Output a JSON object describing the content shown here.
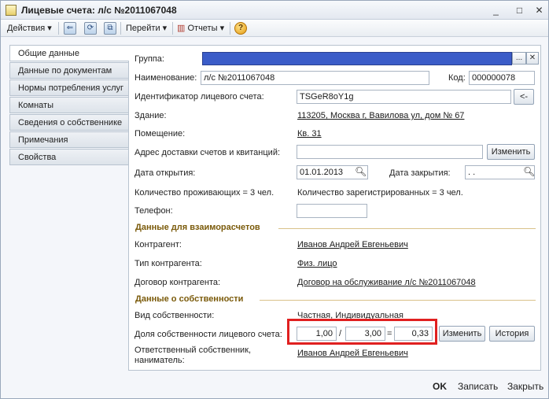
{
  "window": {
    "title": "Лицевые счета: л/с №2011067048"
  },
  "window_controls": {
    "minimize": "_",
    "maximize": "□",
    "close": "✕"
  },
  "toolbar": {
    "actions_label": "Действия",
    "goto_label": "Перейти",
    "reports_label": "Отчеты",
    "help_glyph": "?"
  },
  "tabs": [
    {
      "label": "Общие данные",
      "active": true
    },
    {
      "label": "Данные по документам"
    },
    {
      "label": "Нормы потребления услуг"
    },
    {
      "label": "Комнаты"
    },
    {
      "label": "Сведения о собственнике"
    },
    {
      "label": "Примечания"
    },
    {
      "label": "Свойства"
    }
  ],
  "form": {
    "group_label": "Группа:",
    "group_value": "",
    "group_select": "...",
    "group_clear": "✕",
    "name_label": "Наименование:",
    "name_value": "л/с №2011067048",
    "code_label": "Код:",
    "code_value": "000000078",
    "account_id_label": "Идентификатор лицевого счета:",
    "account_id_value": "TSGeR8oY1g",
    "account_id_btn": "<-",
    "building_label": "Здание:",
    "building_value": "113205, Москва г, Вавилова ул, дом № 67",
    "premises_label": "Помещение:",
    "premises_value": "Кв. 31",
    "delivery_label": "Адрес доставки счетов и квитанций:",
    "delivery_value": "",
    "delivery_btn": "Изменить",
    "open_date_label": "Дата открытия:",
    "open_date_value": "01.01.2013",
    "close_date_label": "Дата закрытия:",
    "close_date_value": " .  .",
    "residents_text": "Количество проживающих = 3 чел.",
    "registered_text": "Количество зарегистрированных = 3 чел.",
    "phone_label": "Телефон:",
    "phone_value": ""
  },
  "settlements": {
    "heading": "Данные для взаиморасчетов",
    "counterparty_label": "Контрагент:",
    "counterparty_value": "Иванов Андрей Евгеньевич",
    "type_label": "Тип контрагента:",
    "type_value": "Физ. лицо",
    "contract_label": "Договор контрагента:",
    "contract_value": "Договор на обслуживание л/с №2011067048"
  },
  "ownership": {
    "heading": "Данные о собственности",
    "kind_label": "Вид собственности:",
    "kind_value": "Частная, Индивидуальная",
    "share_label": "Доля собственности лицевого счета:",
    "numerator": "1,00",
    "slash": "/",
    "denominator": "3,00",
    "equals": "=",
    "result": "0,33",
    "change_btn": "Изменить",
    "history_btn": "История",
    "responsible_label_1": "Ответственный собственник,",
    "responsible_label_2": "наниматель:",
    "responsible_value": "Иванов Андрей Евгеньевич"
  },
  "footer": {
    "ok": "OK",
    "save": "Записать",
    "close": "Закрыть"
  },
  "colors": {
    "highlight": "#e02020",
    "group_field": "#3b5cc8",
    "section_heading": "#7a5a0a"
  }
}
